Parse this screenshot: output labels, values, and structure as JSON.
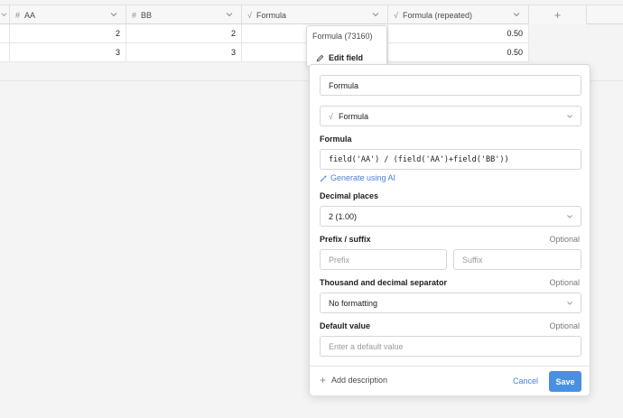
{
  "columns": [
    {
      "icon": "#",
      "label": "AA"
    },
    {
      "icon": "#",
      "label": "BB"
    },
    {
      "icon": "√",
      "label": "Formula"
    },
    {
      "icon": "√",
      "label": "Formula (repeated)"
    }
  ],
  "add_column_label": "+",
  "rows": [
    {
      "aa": "2",
      "bb": "2",
      "formula": "",
      "repeated": "0.50"
    },
    {
      "aa": "3",
      "bb": "3",
      "formula": "",
      "repeated": "0.50"
    }
  ],
  "context_menu": {
    "title": "Formula (73160)",
    "edit_label": "Edit field"
  },
  "form": {
    "name_value": "Formula",
    "type_value": "Formula",
    "formula_label": "Formula",
    "formula_value": "field('AA') / (field('AA')+field('BB'))",
    "generate_ai_label": "Generate using AI",
    "decimal_label": "Decimal places",
    "decimal_value": "2 (1.00)",
    "prefix_suffix_label": "Prefix / suffix",
    "optional_label": "Optional",
    "prefix_placeholder": "Prefix",
    "suffix_placeholder": "Suffix",
    "separator_label": "Thousand and decimal separator",
    "separator_value": "No formatting",
    "default_label": "Default value",
    "default_placeholder": "Enter a default value",
    "add_description_label": "Add description",
    "cancel_label": "Cancel",
    "save_label": "Save"
  },
  "colors": {
    "accent": "#4a90e2",
    "link": "#4a7fd6"
  }
}
